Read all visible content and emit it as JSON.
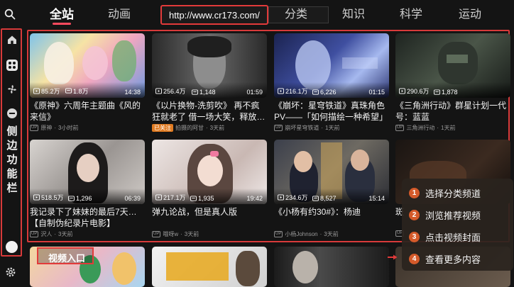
{
  "nav": {
    "tabs": [
      {
        "label": "全站",
        "active": true
      },
      {
        "label": "动画"
      },
      {
        "label": "分类"
      },
      {
        "label": "知识"
      },
      {
        "label": "科学"
      },
      {
        "label": "运动"
      }
    ],
    "url": "http://www.cr173.com/",
    "search_icon": "search-icon"
  },
  "sidebar": {
    "icons": [
      "home-icon",
      "apps-icon",
      "fan-icon",
      "minus-circle-icon"
    ],
    "label": "侧边功能栏",
    "settings_icon": "gear-icon"
  },
  "videos": [
    {
      "views": "85.2万",
      "danmaku": "1.8万",
      "duration": "14:38",
      "title": "《原神》六周年主题曲《风的来信》",
      "uploader": "原神",
      "time": "3小时前",
      "badge": "UP"
    },
    {
      "views": "256.4万",
      "danmaku": "1,148",
      "duration": "01:59",
      "title": "《以片换物-洗剪吹》 再不疯狂就老了 借一场大笑，释放…",
      "uploader": "拍摄的阿甘",
      "time": "3天前",
      "badge": "已关注"
    },
    {
      "views": "216.1万",
      "danmaku": "6,226",
      "duration": "01:15",
      "title": "《崩坏：星穹铁道》真珠角色PV——「如何描绘一种希望」",
      "uploader": "崩坏星穹铁道",
      "time": "1天前",
      "badge": "UP"
    },
    {
      "views": "290.6万",
      "danmaku": "1,878",
      "duration": "",
      "title": "《三角洲行动》群星计划一代号：蓝蓝",
      "uploader": "三角洲行动",
      "time": "1天前",
      "badge": "UP"
    },
    {
      "views": "518.5万",
      "danmaku": "1,296",
      "duration": "06:39",
      "title": "我记录下了妹妹的最后7天…【自制伪纪录片电影】",
      "uploader": "沢人",
      "time": "3天前",
      "badge": "UP"
    },
    {
      "views": "217.1万",
      "danmaku": "1,935",
      "duration": "19:42",
      "title": "弹九论战，但是真人版",
      "uploader": "哦呀w",
      "time": "3天前",
      "badge": "UP"
    },
    {
      "views": "234.6万",
      "danmaku": "8,527",
      "duration": "15:14",
      "title": "《小杨有约30#》：杨迪",
      "uploader": "小杨Johnson",
      "time": "3天前",
      "badge": "UP"
    },
    {
      "views": "",
      "danmaku": "",
      "duration": "",
      "title": "斑",
      "uploader": "",
      "time": "",
      "badge": "UP"
    }
  ],
  "bottom": {
    "entry_label": "视频入口"
  },
  "steps": [
    {
      "num": "1",
      "text": "选择分类频道"
    },
    {
      "num": "2",
      "text": "浏览推荐视频"
    },
    {
      "num": "3",
      "text": "点击视频封面"
    },
    {
      "num": "4",
      "text": "查看更多内容"
    }
  ],
  "colors": {
    "highlight": "#e23a3a",
    "accent": "#ff4a5e",
    "step_badge": "#d45a2a"
  }
}
